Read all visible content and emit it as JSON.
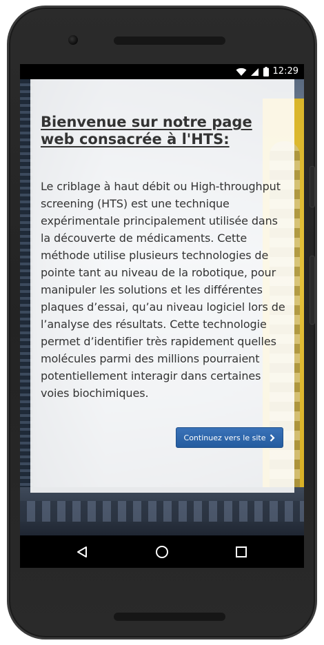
{
  "status_bar": {
    "time": "12:29",
    "icons": [
      "wifi-icon",
      "cell-signal-icon",
      "battery-icon"
    ]
  },
  "page": {
    "title": "Bienvenue sur notre page web consacrée à l'HTS:",
    "intro": "Le criblage à haut débit ou High-throughput screening (HTS) est une technique expérimentale principalement utilisée dans la découverte de médicaments. Cette méthode utilise plusieurs technologies de pointe tant au niveau de la robotique, pour manipuler les solutions et les différentes plaques d’essai, qu’au niveau logiciel lors de l’analyse des résultats. Cette technologie permet d’identifier très rapidement quelles molécules parmi des millions pourraient potentiellement interagir dans certaines voies biochimiques.",
    "cta_label": "Continuez vers le site"
  },
  "nav_bar": {
    "buttons": [
      "back-icon",
      "home-icon",
      "recents-icon"
    ]
  },
  "colors": {
    "button": "#2d67ad",
    "text": "#333333",
    "yellow_background": "#e0bb33"
  }
}
